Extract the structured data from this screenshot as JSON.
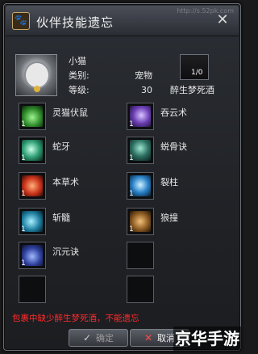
{
  "window": {
    "title": "伙伴技能遗忘",
    "close_label": "✕",
    "watermark": "http://s.52pk.com"
  },
  "pet": {
    "name": "小猫",
    "type_label": "类别:",
    "type_value": "宠物",
    "level_label": "等级:",
    "level_value": "30"
  },
  "required_item": {
    "name": "醉生梦死酒",
    "count": "1/0"
  },
  "skills": [
    {
      "name": "灵猫伏鼠",
      "level": "1",
      "icon": "green-cat-icon"
    },
    {
      "name": "吞云术",
      "level": "1",
      "icon": "purple-cloud-icon"
    },
    {
      "name": "蛇牙",
      "level": "1",
      "icon": "jade-fang-icon"
    },
    {
      "name": "蜕骨诀",
      "level": "1",
      "icon": "teal-figure-icon"
    },
    {
      "name": "本草术",
      "level": "1",
      "icon": "red-swirl-icon"
    },
    {
      "name": "裂柱",
      "level": "1",
      "icon": "blue-pillar-icon"
    },
    {
      "name": "斩髓",
      "level": "1",
      "icon": "cyan-slash-icon"
    },
    {
      "name": "狼撞",
      "level": "1",
      "icon": "bronze-wolf-icon"
    },
    {
      "name": "沉元诀",
      "level": "1",
      "icon": "indigo-orb-icon"
    }
  ],
  "warning": "包裹中缺少醉生梦死酒，不能遗忘",
  "buttons": {
    "ok": "确定",
    "ok_glyph": "✓",
    "cancel": "取消",
    "cancel_glyph": "✕"
  },
  "brand": "京华手游"
}
